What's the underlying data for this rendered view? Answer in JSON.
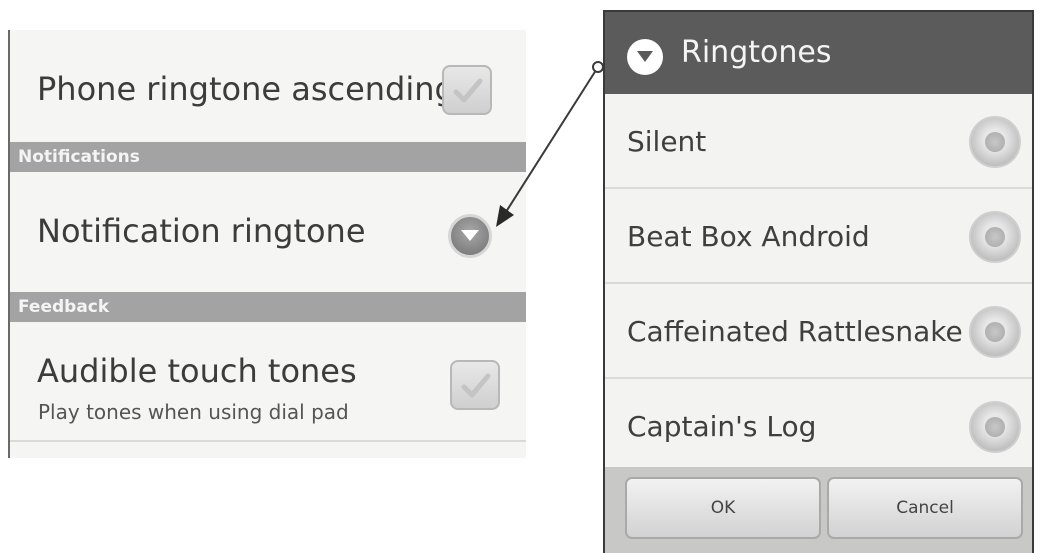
{
  "settings": {
    "phone_ringtone_ascending": {
      "title": "Phone ringtone ascending",
      "checked": true
    },
    "notifications_category": "Notifications",
    "notification_ringtone": {
      "title": "Notification ringtone"
    },
    "feedback_category": "Feedback",
    "audible_touch_tones": {
      "title": "Audible touch tones",
      "summary": "Play tones when using dial pad",
      "checked": true
    }
  },
  "dialog": {
    "title": "Ringtones",
    "items": [
      {
        "label": "Silent",
        "selected": false
      },
      {
        "label": "Beat Box Android",
        "selected": false
      },
      {
        "label": "Caffeinated Rattlesnake",
        "selected": false
      },
      {
        "label": "Captain's Log",
        "selected": false
      }
    ],
    "ok_label": "OK",
    "cancel_label": "Cancel"
  },
  "icons": {
    "checkbox": "checkmark-icon",
    "dropdown": "chevron-down-icon",
    "arrow": "arrow-icon"
  },
  "colors": {
    "category_bar": "#a3a3a3",
    "dialog_header": "#5b5b5b",
    "panel_background": "#f5f5f3"
  }
}
